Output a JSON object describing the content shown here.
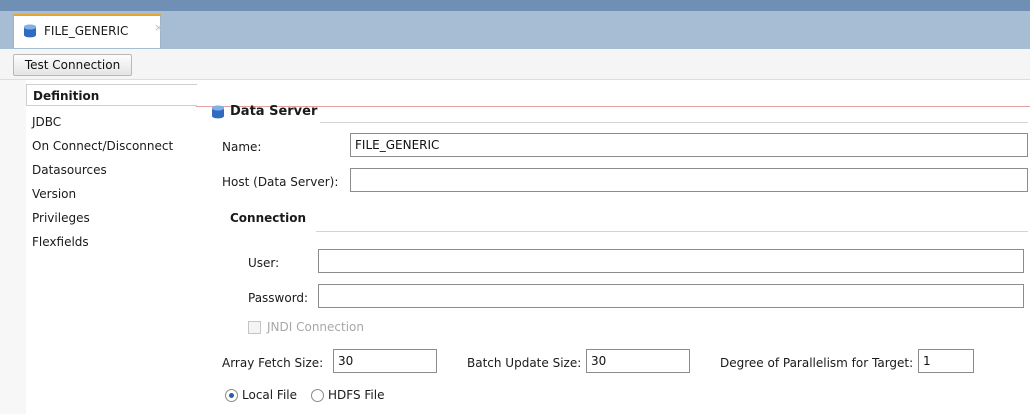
{
  "tab": {
    "title": "FILE_GENERIC",
    "close": "×"
  },
  "toolbar": {
    "test_connection_label": "Test Connection"
  },
  "nav": {
    "items": [
      {
        "label": "Definition",
        "selected": true
      },
      {
        "label": "JDBC"
      },
      {
        "label": "On Connect/Disconnect"
      },
      {
        "label": "Datasources"
      },
      {
        "label": "Version"
      },
      {
        "label": "Privileges"
      },
      {
        "label": "Flexfields"
      }
    ]
  },
  "main": {
    "section_title": "Data Server",
    "name_label": "Name:",
    "name_value": "FILE_GENERIC",
    "host_label": "Host (Data Server):",
    "host_value": "",
    "connection": {
      "title": "Connection",
      "user_label": "User:",
      "user_value": "",
      "password_label": "Password:",
      "password_value": "",
      "jndi_label": "JNDI Connection",
      "jndi_checked": false
    },
    "array_fetch_label": "Array Fetch Size:",
    "array_fetch_value": "30",
    "batch_update_label": "Batch Update Size:",
    "batch_update_value": "30",
    "parallelism_label": "Degree of Parallelism for Target:",
    "parallelism_value": "1",
    "local_file_label": "Local File",
    "hdfs_file_label": "HDFS File",
    "selected_file_option": "Local File"
  },
  "colors": {
    "accent": "#e3a72f",
    "tabbar": "#a7bdd4",
    "topband": "#6f8fb5",
    "icon": "#3d78c9"
  }
}
